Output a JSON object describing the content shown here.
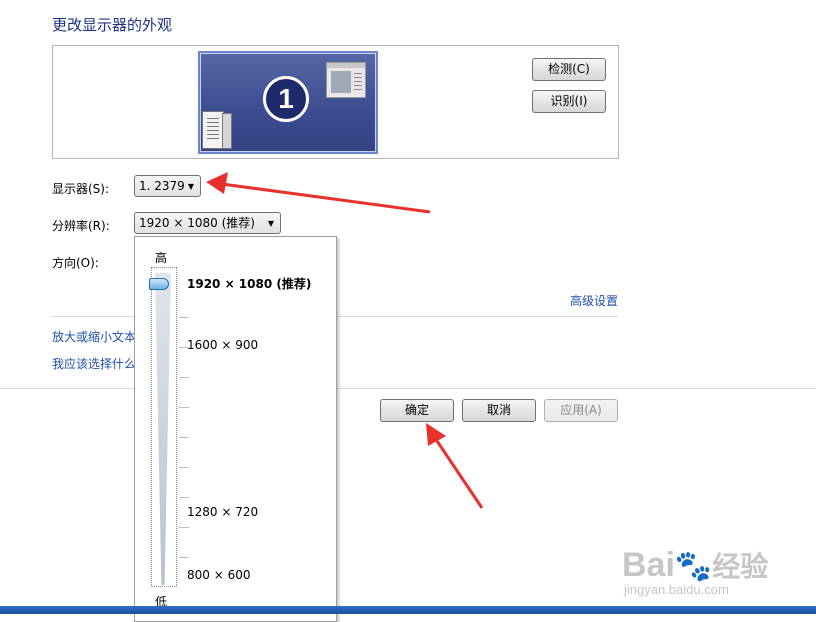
{
  "title": "更改显示器的外观",
  "preview": {
    "monitor_number": "1",
    "detect_label": "检测(C)",
    "identify_label": "识别(I)"
  },
  "fields": {
    "display_label": "显示器(S):",
    "display_value": "1. 2379",
    "resolution_label": "分辨率(R):",
    "resolution_value": "1920 × 1080 (推荐)",
    "orientation_label": "方向(O):"
  },
  "advanced_link": "高级设置",
  "links": {
    "text_size": "放大或缩小文本",
    "which_settings": "我应该选择什么"
  },
  "buttons": {
    "ok": "确定",
    "cancel": "取消",
    "apply": "应用(A)"
  },
  "resolution_dropdown": {
    "high_label": "高",
    "low_label": "低",
    "options": [
      {
        "label": "1920 × 1080 (推荐)",
        "selected": true
      },
      {
        "label": "1600 × 900",
        "selected": false
      },
      {
        "label": "1280 × 720",
        "selected": false
      },
      {
        "label": "800 × 600",
        "selected": false
      }
    ]
  },
  "watermark": {
    "brand": "Bai",
    "brand2": "经验",
    "url": "jingyan.baidu.com"
  },
  "colors": {
    "title": "#1e3287",
    "link": "#1e50a8",
    "annotation_arrow": "#e8312d",
    "monitor_blue": "#3e4e92"
  }
}
